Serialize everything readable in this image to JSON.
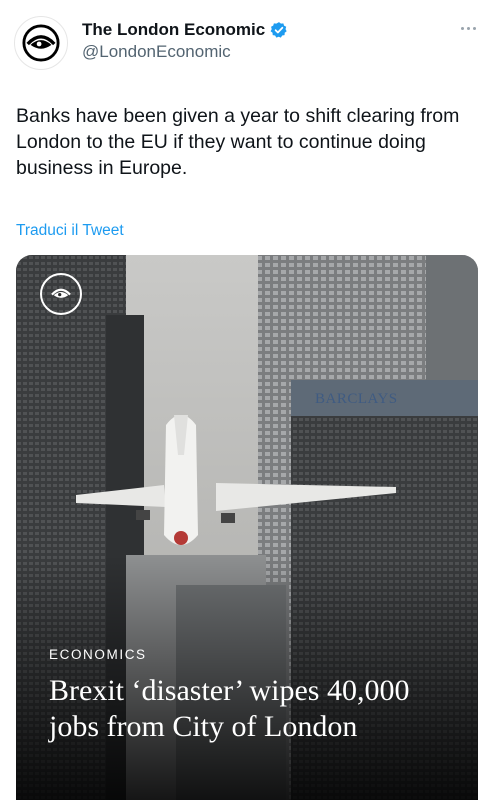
{
  "account": {
    "display_name": "The London Economic",
    "handle": "@LondonEconomic",
    "verified_icon": "verified-badge-icon",
    "verified_color": "#1d9bf0"
  },
  "tweet": {
    "text": "Banks have been given a year to shift clearing from London to the EU if they want to continue doing business in Europe.",
    "translate_label": "Traduci il Tweet"
  },
  "card": {
    "category": "ECONOMICS",
    "headline": "Brexit ‘disaster’ wipes 40,000 jobs from City of London",
    "building_sign": "BARCLAYS"
  },
  "colors": {
    "link": "#1d9bf0",
    "secondary_text": "#536471",
    "primary_text": "#0f1419"
  }
}
